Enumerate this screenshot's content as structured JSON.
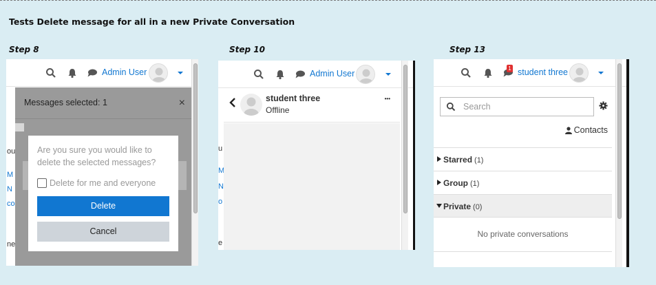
{
  "page_title": "Tests Delete message for all in a new Private Conversation",
  "steps": [
    {
      "label": "Step 8"
    },
    {
      "label": "Step 10"
    },
    {
      "label": "Step 13"
    }
  ],
  "step8": {
    "user_name": "Admin User",
    "selected_text": "Messages selected: 1",
    "close_glyph": "×",
    "dialog_question": "Are you sure you would like to delete the selected messages?",
    "checkbox_label": "Delete for me and everyone",
    "delete_label": "Delete",
    "cancel_label": "Cancel",
    "left_fragments": [
      "ou",
      "M",
      "N",
      "co",
      "ne"
    ]
  },
  "step10": {
    "user_name": "Admin User",
    "contact_name": "student three",
    "contact_status": "Offline",
    "more_glyph": "•••",
    "left_fragments": [
      "u",
      "M",
      "N",
      "o",
      "e"
    ]
  },
  "step13": {
    "user_name": "student three",
    "badge_count": "1",
    "search_placeholder": "Search",
    "contacts_label": "Contacts",
    "sections": [
      {
        "label": "Starred",
        "count": "(1)",
        "expanded": false
      },
      {
        "label": "Group",
        "count": "(1)",
        "expanded": false
      },
      {
        "label": "Private",
        "count": "(0)",
        "expanded": true
      }
    ],
    "empty_text": "No private conversations"
  },
  "colors": {
    "background": "#daedf3",
    "link": "#1177d1",
    "primary_button": "#1177d1",
    "overlay": "#9a9a9a",
    "badge": "#e03030"
  }
}
